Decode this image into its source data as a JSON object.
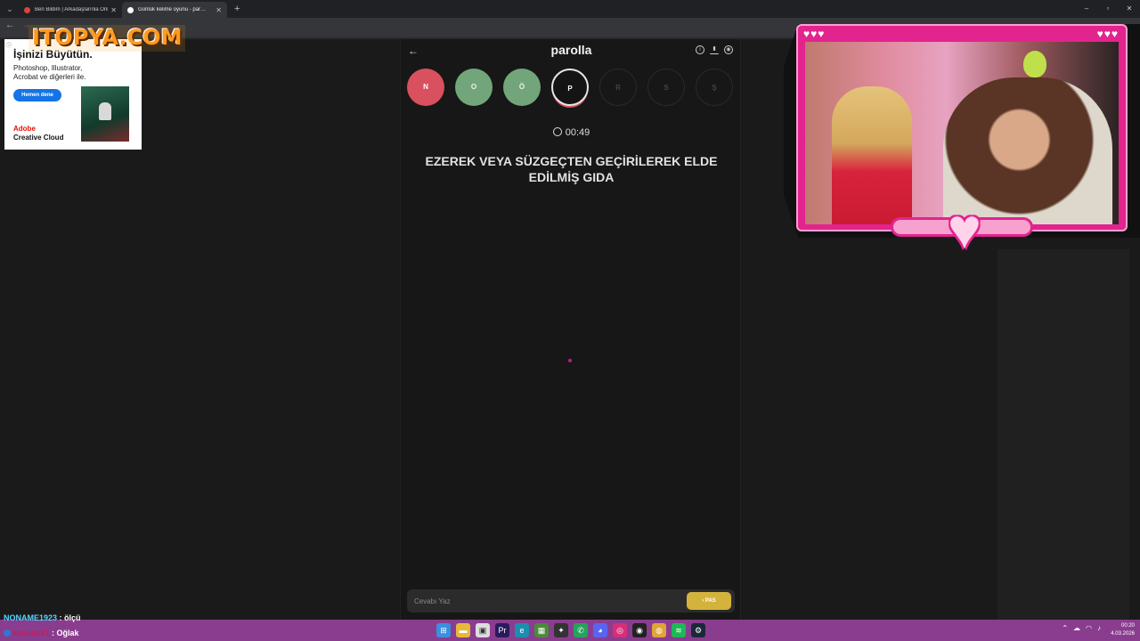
{
  "browser": {
    "tabs": [
      {
        "title": "Ben Bildim | Arkadaşlarınla Onl…",
        "favicon_color": "#d9453b"
      },
      {
        "title": "Günlük kelime oyunu - par…",
        "favicon_color": "#ffffff"
      }
    ],
    "new_tab": "+",
    "window_controls": {
      "minimize": "–",
      "maximize": "▫",
      "close": "✕"
    }
  },
  "overlay_logo": "ITOPYA.COM",
  "ad": {
    "info": "ⓘ",
    "headline": "İşinizi Büyütün.",
    "subtext": "Photoshop, Illustrator, Acrobat ve diğerleri ile.",
    "cta": "Hemen dene",
    "brand_line1": "Adobe",
    "brand_line2": "Creative Cloud"
  },
  "game": {
    "title": "parolla",
    "back_icon": "←",
    "icons": [
      "info-icon",
      "stats-icon",
      "profile-icon"
    ],
    "letters": [
      {
        "char": "N",
        "state": "wrong"
      },
      {
        "char": "O",
        "state": "correct"
      },
      {
        "char": "Ö",
        "state": "correct"
      },
      {
        "char": "P",
        "state": "current"
      },
      {
        "char": "R",
        "state": "pending"
      },
      {
        "char": "S",
        "state": "pending"
      },
      {
        "char": "Ş",
        "state": "pending"
      }
    ],
    "timer": "00:49",
    "question": "EZEREK VEYA SÜZGEÇTEN GEÇİRİLEREK ELDE EDİLMİŞ GIDA",
    "answer_placeholder": "Cevabı Yaz",
    "pass_label": "› PAS"
  },
  "colors": {
    "wrong": "#d9505f",
    "correct": "#73a57a",
    "accent_pass": "#d4b33d",
    "frame_pink": "#e2248f",
    "taskbar": "#8a3d8f"
  },
  "chat": [
    {
      "user": "NONAME1923",
      "message": " : ölçü"
    },
    {
      "user": "kasuhu91",
      "message": " : Oğlak"
    }
  ],
  "tray": {
    "time": "00:20",
    "date": "4.03.2026"
  }
}
